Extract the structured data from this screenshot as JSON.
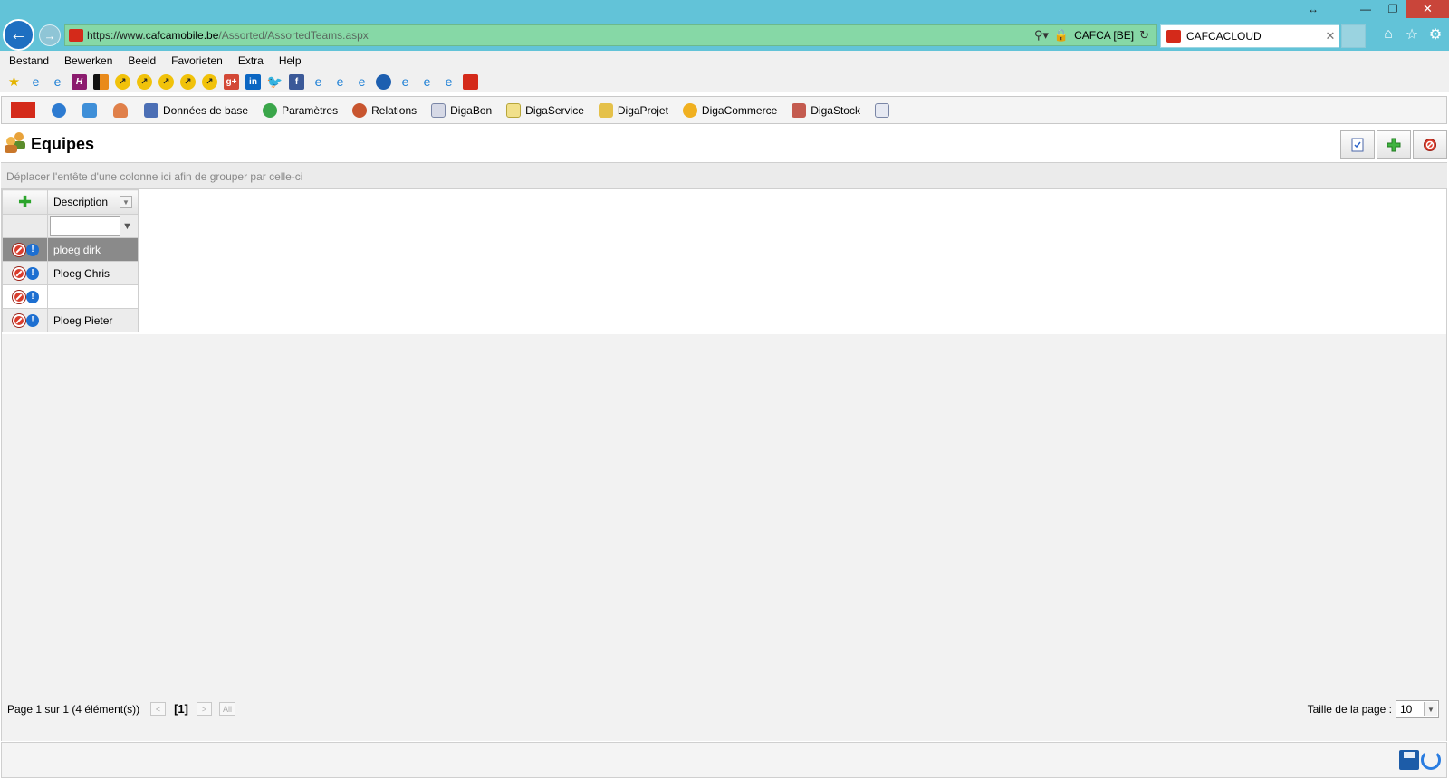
{
  "browser": {
    "url_scheme": "https://www.",
    "url_domain": "cafcamobile.be",
    "url_path": "/Assorted/AssortedTeams.aspx",
    "site_identity": "CAFCA [BE]",
    "tab_title": "CAFCACLOUD"
  },
  "menu": [
    "Bestand",
    "Bewerken",
    "Beeld",
    "Favorieten",
    "Extra",
    "Help"
  ],
  "toolbar": {
    "items": [
      "Données de base",
      "Paramètres",
      "Relations",
      "DigaBon",
      "DigaService",
      "DigaProjet",
      "DigaCommerce",
      "DigaStock"
    ],
    "logo_text": "CAFCA"
  },
  "page": {
    "title": "Equipes"
  },
  "grid": {
    "group_hint": "Déplacer l'entête d'une colonne ici afin de grouper par celle-ci",
    "column_header": "Description",
    "filter_value": "",
    "rows": [
      {
        "description": "ploeg dirk",
        "selected": true
      },
      {
        "description": "Ploeg Chris",
        "selected": false
      },
      {
        "description": "",
        "selected": false
      },
      {
        "description": "Ploeg Pieter",
        "selected": false
      }
    ]
  },
  "pager": {
    "summary": "Page 1 sur 1 (4 élément(s))",
    "current": "[1]",
    "prev": "<",
    "next": ">",
    "all": "All",
    "page_size_label": "Taille de la page :",
    "page_size": "10"
  },
  "colors": {
    "chrome": "#62c3d8",
    "address_bar": "#86d8a6",
    "brand_red": "#d42a1a",
    "selected_row": "#8a8a8a"
  }
}
